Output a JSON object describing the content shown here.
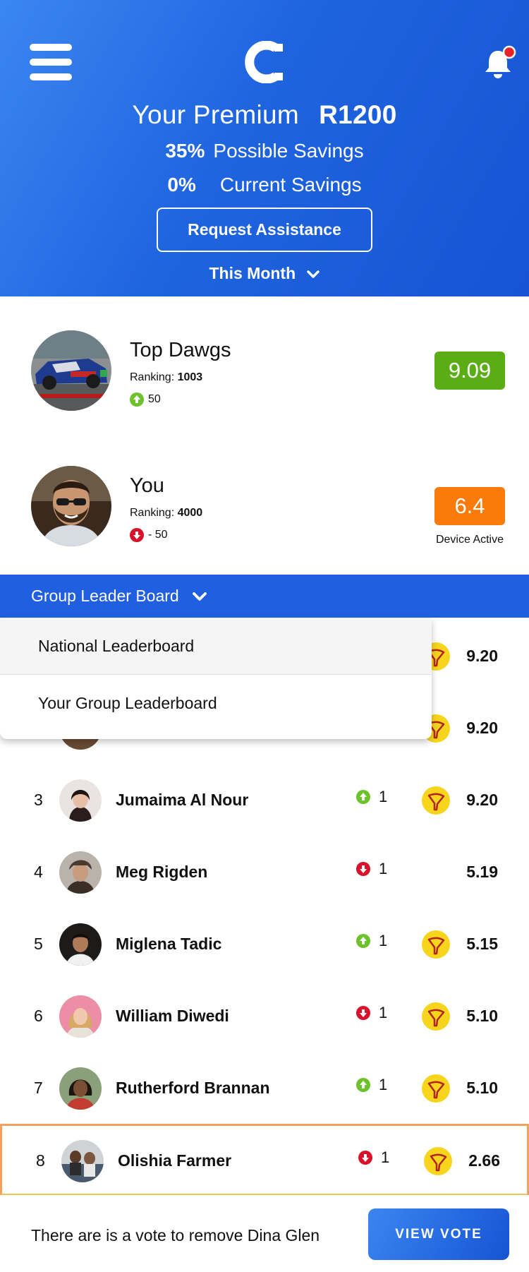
{
  "header": {
    "premium_label": "Your Premium",
    "premium_value": "R1200",
    "possible_savings_pct": "35%",
    "possible_savings_label": "Possible Savings",
    "current_savings_pct": "0%",
    "current_savings_label": "Current Savings",
    "assist_button": "Request Assistance",
    "period_label": "This Month"
  },
  "top_card": {
    "title": "Top Dawgs",
    "ranking_label": "Ranking:",
    "ranking_value": "1003",
    "delta": "50",
    "score": "9.09",
    "score_color": "#5aad14"
  },
  "you_card": {
    "title": "You",
    "ranking_label": "Ranking:",
    "ranking_value": "4000",
    "delta": "- 50",
    "score": "6.4",
    "score_color": "#fa7a0a",
    "status": "Device Active"
  },
  "board": {
    "selected": "Group Leader Board",
    "options": [
      "National Leaderboard",
      "Your Group Leaderboard"
    ]
  },
  "leaderboard": [
    {
      "score": "9.20",
      "coin": true
    },
    {
      "score": "9.20",
      "coin": true
    },
    {
      "rank": "3",
      "name": "Jumaima Al Nour",
      "trend": "up",
      "delta": "1",
      "coin": true,
      "score": "9.20"
    },
    {
      "rank": "4",
      "name": "Meg Rigden",
      "trend": "down",
      "delta": "1",
      "coin": false,
      "score": "5.19"
    },
    {
      "rank": "5",
      "name": "Miglena Tadic",
      "trend": "up",
      "delta": "1",
      "coin": true,
      "score": "5.15"
    },
    {
      "rank": "6",
      "name": "William Diwedi",
      "trend": "down",
      "delta": "1",
      "coin": true,
      "score": "5.10"
    },
    {
      "rank": "7",
      "name": "Rutherford Brannan",
      "trend": "up",
      "delta": "1",
      "coin": true,
      "score": "5.10"
    },
    {
      "rank": "8",
      "name": "Olishia Farmer",
      "trend": "down",
      "delta": "1",
      "coin": true,
      "score": "2.66"
    }
  ],
  "footer": {
    "message": "There are is a vote to remove Dina Glen",
    "button": "VIEW VOTE"
  },
  "colors": {
    "brand_blue": "#1f5fe0",
    "up_green": "#6cc22a",
    "down_red": "#d8122a",
    "coin_yellow": "#f7d51c"
  }
}
